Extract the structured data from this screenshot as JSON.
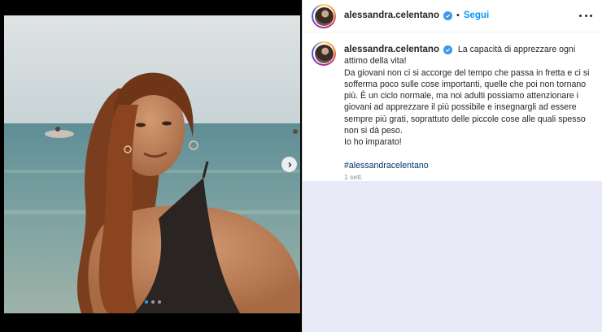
{
  "header": {
    "username": "alessandra.celentano",
    "separator": "•",
    "follow_label": "Segui",
    "more_icon": "more-horizontal-icon"
  },
  "caption": {
    "username": "alessandra.celentano",
    "lines": [
      "La capacità di apprezzare ogni attimo della vita!",
      "Da giovani non ci si accorge del tempo che passa in fretta e ci si sofferma poco sulle cose importanti, quelle che poi non tornano più. È un ciclo normale, ma noi adulti possiamo attenzionare i giovani ad apprezzare il più possibile e insegnargli ad essere sempre più grati, soprattuto delle piccole cose alle quali spesso non si dà peso.",
      "Io ho imparato!"
    ],
    "hashtag": "#alessandracelentano",
    "time": "1 sett."
  },
  "carousel": {
    "total": 3,
    "active_index": 0,
    "next_icon": "chevron-right-icon"
  },
  "colors": {
    "accent": "#0095f6",
    "verified": "#3897f0",
    "text": "#262626",
    "muted": "#8e8e8e",
    "hashtag": "#00376b",
    "lower_panel": "#e9eaf7"
  }
}
